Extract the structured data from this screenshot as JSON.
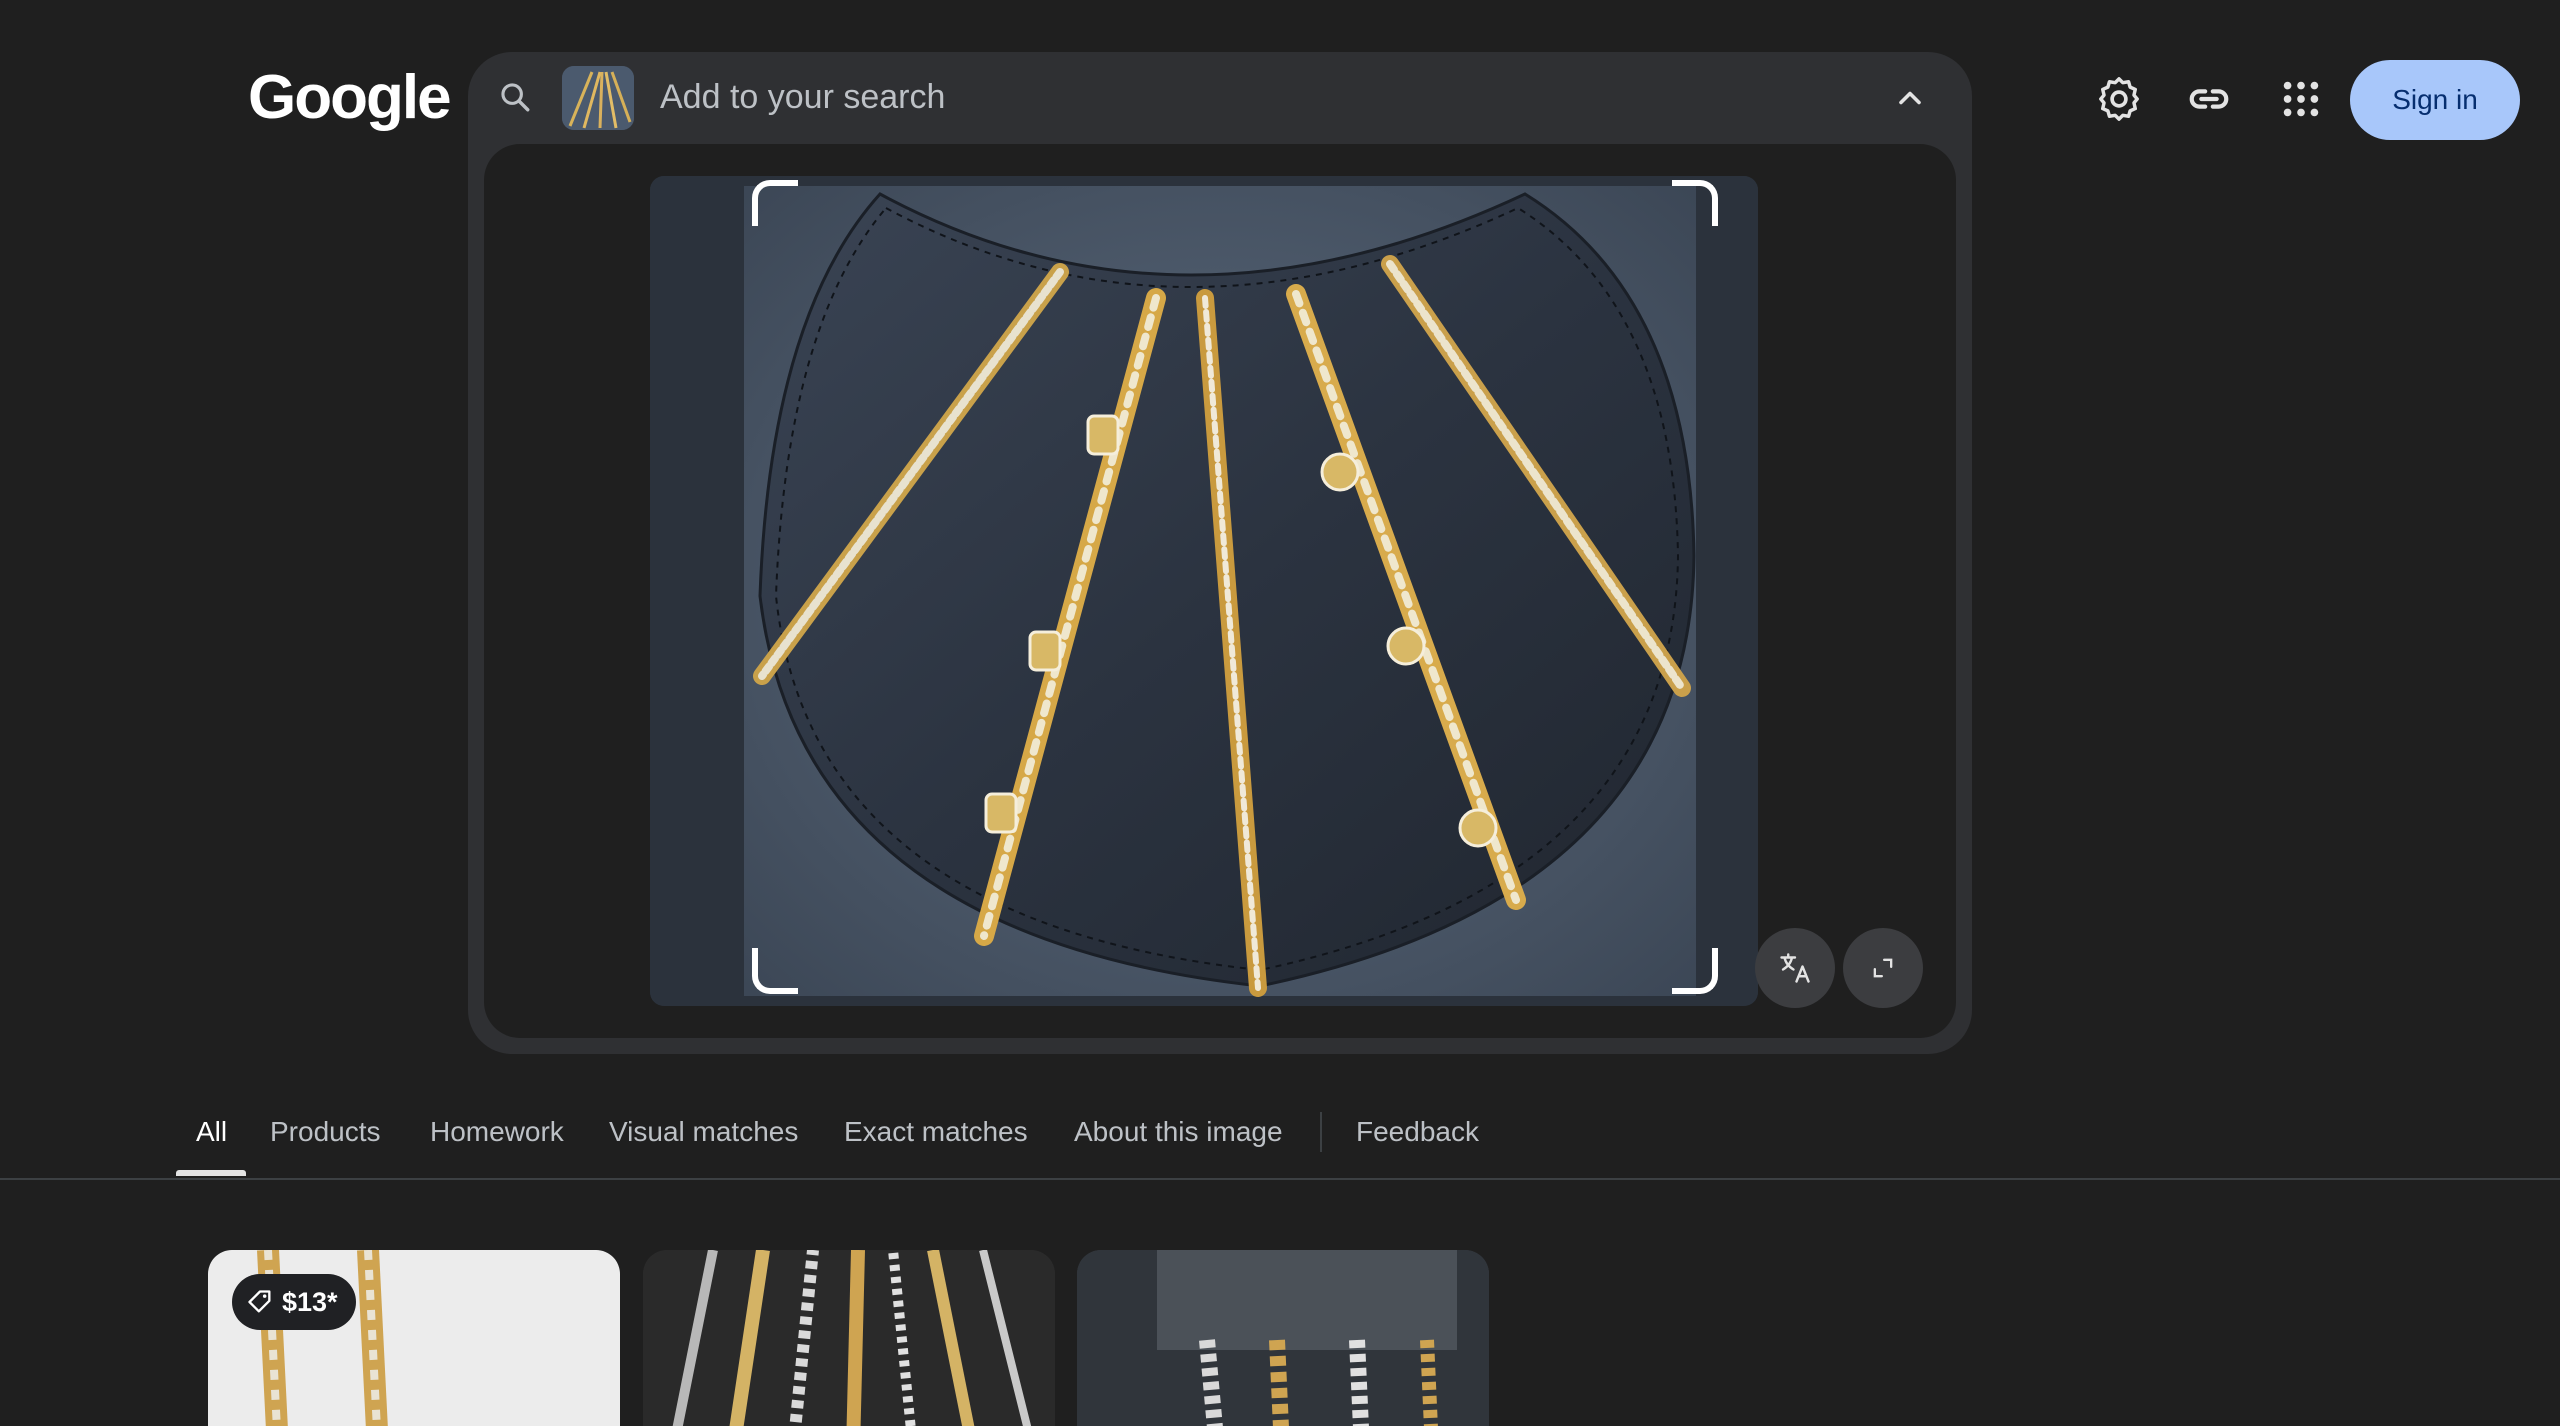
{
  "header": {
    "logo_text": "Google",
    "search_placeholder": "Add to your search",
    "signin_label": "Sign in"
  },
  "tabs": [
    {
      "label": "All",
      "active": true
    },
    {
      "label": "Products"
    },
    {
      "label": "Homework"
    },
    {
      "label": "Visual matches"
    },
    {
      "label": "Exact matches"
    },
    {
      "label": "About this image"
    },
    {
      "label": "Feedback"
    }
  ],
  "results": [
    {
      "price": "$13*"
    },
    {},
    {}
  ],
  "icons": {
    "search": "search-icon",
    "collapse": "chevron-up-icon",
    "settings": "gear-icon",
    "link": "link-icon",
    "apps": "apps-grid-icon",
    "translate": "translate-icon",
    "expand": "expand-icon",
    "price_tag": "tag-icon"
  },
  "colors": {
    "background": "#1f1f1f",
    "panel": "#2f3033",
    "signin_bg": "#a8c7fa",
    "signin_text": "#062e6f"
  }
}
